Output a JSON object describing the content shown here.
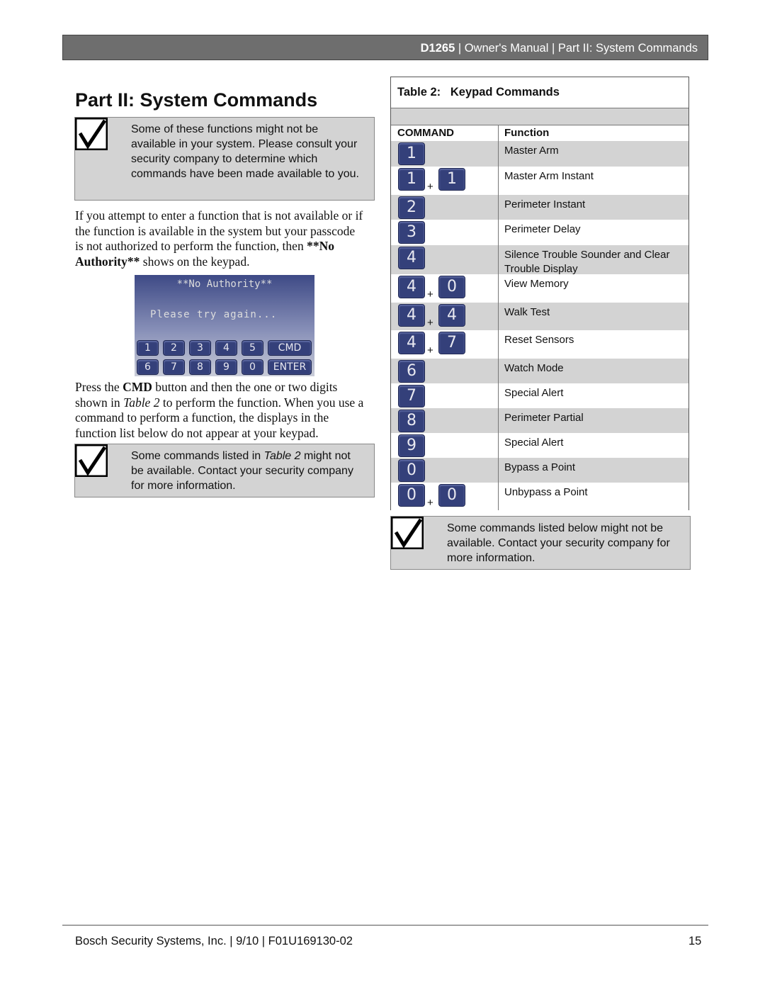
{
  "header": {
    "product": "D1265",
    "rest": " | Owner's Manual | Part II: System Commands"
  },
  "title": "Part II: System Commands",
  "note1": "Some of these functions might not be available in your system. Please consult your security company to determine which commands have been made available to you.",
  "para1": {
    "a": "If you attempt to enter a function that is not available or if the function is available in the system but your passcode is not authorized to perform the function, then ",
    "b": "**No Authority**",
    "c": " shows on the keypad."
  },
  "keypad": {
    "line1": "**No Authority**",
    "line2": "Please try again...",
    "keys": [
      "1",
      "2",
      "3",
      "4",
      "5",
      "CMD",
      "6",
      "7",
      "8",
      "9",
      "0",
      "ENTER"
    ]
  },
  "para2": {
    "a": "Press the ",
    "b": "CMD",
    "c": " button and then the one or two digits shown in ",
    "d": "Table 2",
    "e": " to perform the function. When you use a command to perform a function, the displays in the function list below do not appear at your keypad."
  },
  "note2": {
    "a": "Some commands listed in ",
    "b": "Table 2",
    "c": " might not be available. Contact your security company for more information."
  },
  "table": {
    "title": "Table 2:   Keypad Commands",
    "col1": "COMMAND",
    "col2": "Function",
    "rows": [
      {
        "keys": [
          "1"
        ],
        "fn": "Master Arm"
      },
      {
        "keys": [
          "1",
          "1"
        ],
        "fn": "Master Arm Instant"
      },
      {
        "keys": [
          "2"
        ],
        "fn": "Perimeter Instant"
      },
      {
        "keys": [
          "3"
        ],
        "fn": "Perimeter Delay"
      },
      {
        "keys": [
          "4"
        ],
        "fn": "Silence Trouble Sounder and Clear Trouble Display"
      },
      {
        "keys": [
          "4",
          "0"
        ],
        "fn": "View Memory"
      },
      {
        "keys": [
          "4",
          "4"
        ],
        "fn": "Walk Test"
      },
      {
        "keys": [
          "4",
          "7"
        ],
        "fn": "Reset Sensors"
      },
      {
        "keys": [
          "6"
        ],
        "fn": "Watch Mode"
      },
      {
        "keys": [
          "7"
        ],
        "fn": "Special Alert"
      },
      {
        "keys": [
          "8"
        ],
        "fn": "Perimeter Partial"
      },
      {
        "keys": [
          "9"
        ],
        "fn": "Special Alert"
      },
      {
        "keys": [
          "0"
        ],
        "fn": "Bypass a Point"
      },
      {
        "keys": [
          "0",
          "0"
        ],
        "fn": "Unbypass a Point"
      }
    ],
    "plus": "+"
  },
  "note3": "Some commands listed below might not be available. Contact your security company for more information.",
  "footer": {
    "left": "Bosch Security Systems, Inc. | 9/10 | F01U169130-02",
    "page": "15"
  }
}
